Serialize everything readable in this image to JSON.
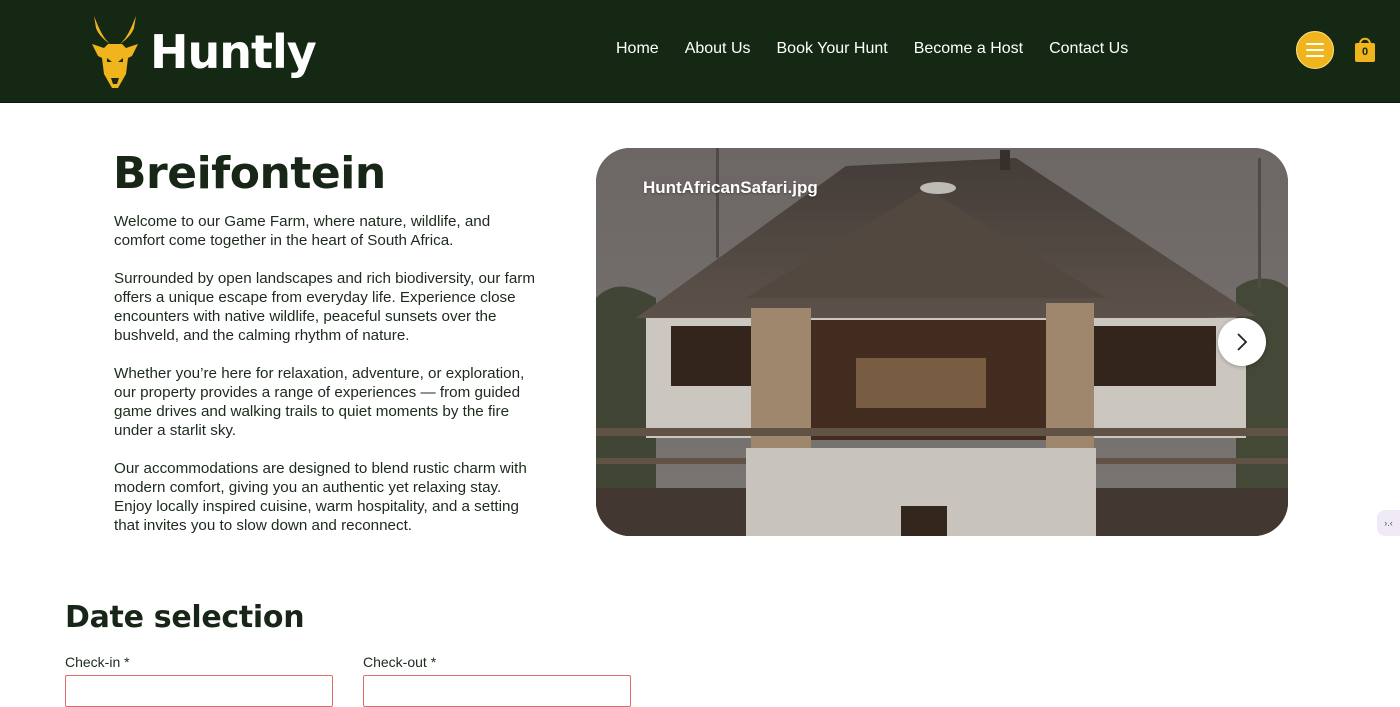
{
  "header": {
    "brand": "Huntly",
    "nav": [
      "Home",
      "About Us",
      "Book Your Hunt",
      "Become a Host",
      "Contact Us"
    ],
    "cart_count": "0",
    "colors": {
      "header_bg": "#152814",
      "accent": "#f0b51c"
    }
  },
  "property": {
    "title": "Breifontein",
    "paragraphs": [
      "Welcome to our Game Farm, where nature, wildlife, and comfort come together in the heart of South Africa.",
      "Surrounded by open landscapes and rich biodiversity, our farm offers a unique escape from everyday life. Experience close encounters with native wildlife, peaceful sunsets over the bushveld, and the calming rhythm of nature.",
      "Whether you’re here for relaxation, adventure, or exploration, our property provides a range of experiences — from guided game drives and walking trails to quiet moments by the fire under a starlit sky.",
      "Our accommodations are designed to blend rustic charm with modern comfort, giving you an authentic yet relaxing stay. Enjoy locally inspired cuisine, warm hospitality, and a setting that invites you to slow down and reconnect."
    ]
  },
  "gallery": {
    "image_title": "HuntAfricanSafari.jpg"
  },
  "date_selection": {
    "title": "Date selection",
    "checkin_label": "Check-in *",
    "checkout_label": "Check-out *"
  },
  "side_widget": {
    "text": "›.‹"
  }
}
